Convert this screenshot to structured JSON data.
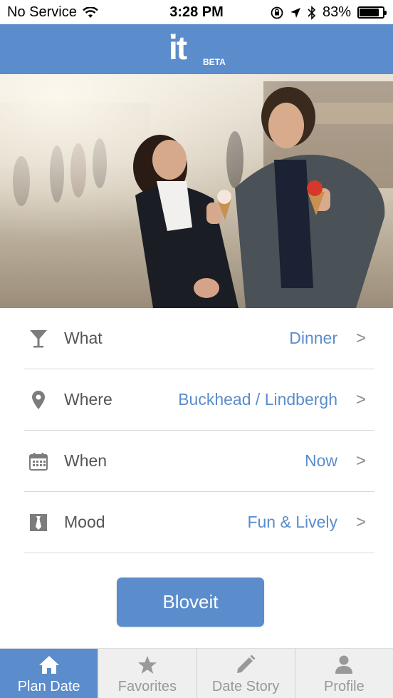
{
  "status_bar": {
    "carrier": "No Service",
    "time": "3:28 PM",
    "battery": "83%",
    "battery_level": 0.83
  },
  "header": {
    "logo_text": "it",
    "badge": "BETA",
    "color": "#5b8ccb"
  },
  "hero": {
    "icon": "photo-couple-with-ice-cream"
  },
  "options": [
    {
      "icon": "cocktail-glass-icon",
      "label": "What",
      "value": "Dinner",
      "chevron": ">"
    },
    {
      "icon": "map-pin-icon",
      "label": "Where",
      "value": "Buckhead / Lindbergh",
      "chevron": ">"
    },
    {
      "icon": "calendar-icon",
      "label": "When",
      "value": "Now",
      "chevron": ">"
    },
    {
      "icon": "tie-icon",
      "label": "Mood",
      "value": "Fun & Lively",
      "chevron": ">"
    }
  ],
  "cta": {
    "label": "Bloveit"
  },
  "tabbar": {
    "tabs": [
      {
        "label": "Plan Date",
        "icon": "home-icon",
        "active": true
      },
      {
        "label": "Favorites",
        "icon": "star-icon",
        "active": false
      },
      {
        "label": "Date Story",
        "icon": "pencil-icon",
        "active": false
      },
      {
        "label": "Profile",
        "icon": "person-icon",
        "active": false
      }
    ]
  },
  "colors": {
    "accent": "#5b8ccb",
    "tab_inactive": "#999999"
  }
}
